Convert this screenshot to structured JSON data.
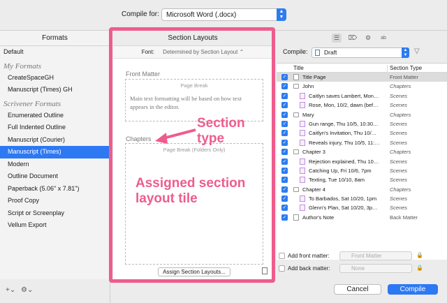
{
  "top": {
    "compile_for_label": "Compile for:",
    "format_value": "Microsoft Word (.docx)"
  },
  "formats": {
    "header": "Formats",
    "default": "Default",
    "my_formats_heading": "My Formats",
    "my_formats": [
      "CreateSpaceGH",
      "Manuscript (Times) GH"
    ],
    "scrivener_heading": "Scrivener Formats",
    "scrivener_formats": [
      "Enumerated Outline",
      "Full Indented Outline",
      "Manuscript (Courier)",
      "Manuscript (Times)",
      "Modern",
      "Outline Document",
      "Paperback (5.06\" x 7.81\")",
      "Proof Copy",
      "Script or Screenplay",
      "Vellum Export"
    ],
    "selected": "Manuscript (Times)"
  },
  "section_layouts": {
    "header": "Section Layouts",
    "font_label": "Font:",
    "font_value": "Determined by Section Layout",
    "front_matter_label": "Front Matter",
    "page_break_label": "Page Break",
    "tile_text": "Main text formatting will be based on how text appears in the editor.",
    "chapters_label": "Chapters",
    "page_break_folders": "Page Break (Folders Only)",
    "assign_button": "Assign Section Layouts..."
  },
  "annotations": {
    "section_type": "Section type",
    "assigned": "Assigned section layout tile",
    "color": "#ee5c8e"
  },
  "contents": {
    "compile_label": "Compile:",
    "compile_value": "Draft",
    "col_title": "Title",
    "col_section_type": "Section Type",
    "rows": [
      {
        "title": "Title Page",
        "type": "Front Matter",
        "indent": 0,
        "kind": "doc",
        "italic": false,
        "selected": true
      },
      {
        "title": "John",
        "type": "Chapters",
        "indent": 0,
        "kind": "folder",
        "italic": true,
        "selected": false
      },
      {
        "title": "Caitlyn saves Lambert, Mon…",
        "type": "Scenes",
        "indent": 1,
        "kind": "doc",
        "italic": true,
        "selected": false
      },
      {
        "title": "Rose, Mon, 10/2, dawn (bef…",
        "type": "Scenes",
        "indent": 1,
        "kind": "doc",
        "italic": true,
        "selected": false
      },
      {
        "title": "Mary",
        "type": "Chapters",
        "indent": 0,
        "kind": "folder",
        "italic": true,
        "selected": false
      },
      {
        "title": "Gun range, Thu 10/5, 10:30…",
        "type": "Scenes",
        "indent": 1,
        "kind": "doc",
        "italic": true,
        "selected": false
      },
      {
        "title": "Caitlyn's Invitation, Thu 10/…",
        "type": "Scenes",
        "indent": 1,
        "kind": "doc",
        "italic": true,
        "selected": false
      },
      {
        "title": "Reveals injury, Thu 10/5, 11:…",
        "type": "Scenes",
        "indent": 1,
        "kind": "doc",
        "italic": true,
        "selected": false
      },
      {
        "title": "Chapter 3",
        "type": "Chapters",
        "indent": 0,
        "kind": "folder",
        "italic": true,
        "selected": false
      },
      {
        "title": "Rejection explained, Thu 10…",
        "type": "Scenes",
        "indent": 1,
        "kind": "doc",
        "italic": true,
        "selected": false
      },
      {
        "title": "Catching Up, Fri 10/6, 7pm",
        "type": "Scenes",
        "indent": 1,
        "kind": "doc",
        "italic": true,
        "selected": false
      },
      {
        "title": "Texting, Tue 10/10, 8am",
        "type": "Scenes",
        "indent": 1,
        "kind": "doc",
        "italic": true,
        "selected": false
      },
      {
        "title": "Chapter 4",
        "type": "Chapters",
        "indent": 0,
        "kind": "folder",
        "italic": true,
        "selected": false
      },
      {
        "title": "To Barbados, Sat 10/20, 1pm",
        "type": "Scenes",
        "indent": 1,
        "kind": "doc",
        "italic": true,
        "selected": false
      },
      {
        "title": "Glenn's Plan, Sat 10/20, 3p…",
        "type": "Scenes",
        "indent": 1,
        "kind": "doc",
        "italic": true,
        "selected": false
      },
      {
        "title": "Author's Note",
        "type": "Back Matter",
        "indent": 0,
        "kind": "doc",
        "italic": false,
        "selected": false
      }
    ],
    "add_front_label": "Add front matter:",
    "add_front_value": "Front Matter",
    "add_back_label": "Add back matter:",
    "add_back_value": "None"
  },
  "buttons": {
    "cancel": "Cancel",
    "compile": "Compile"
  }
}
